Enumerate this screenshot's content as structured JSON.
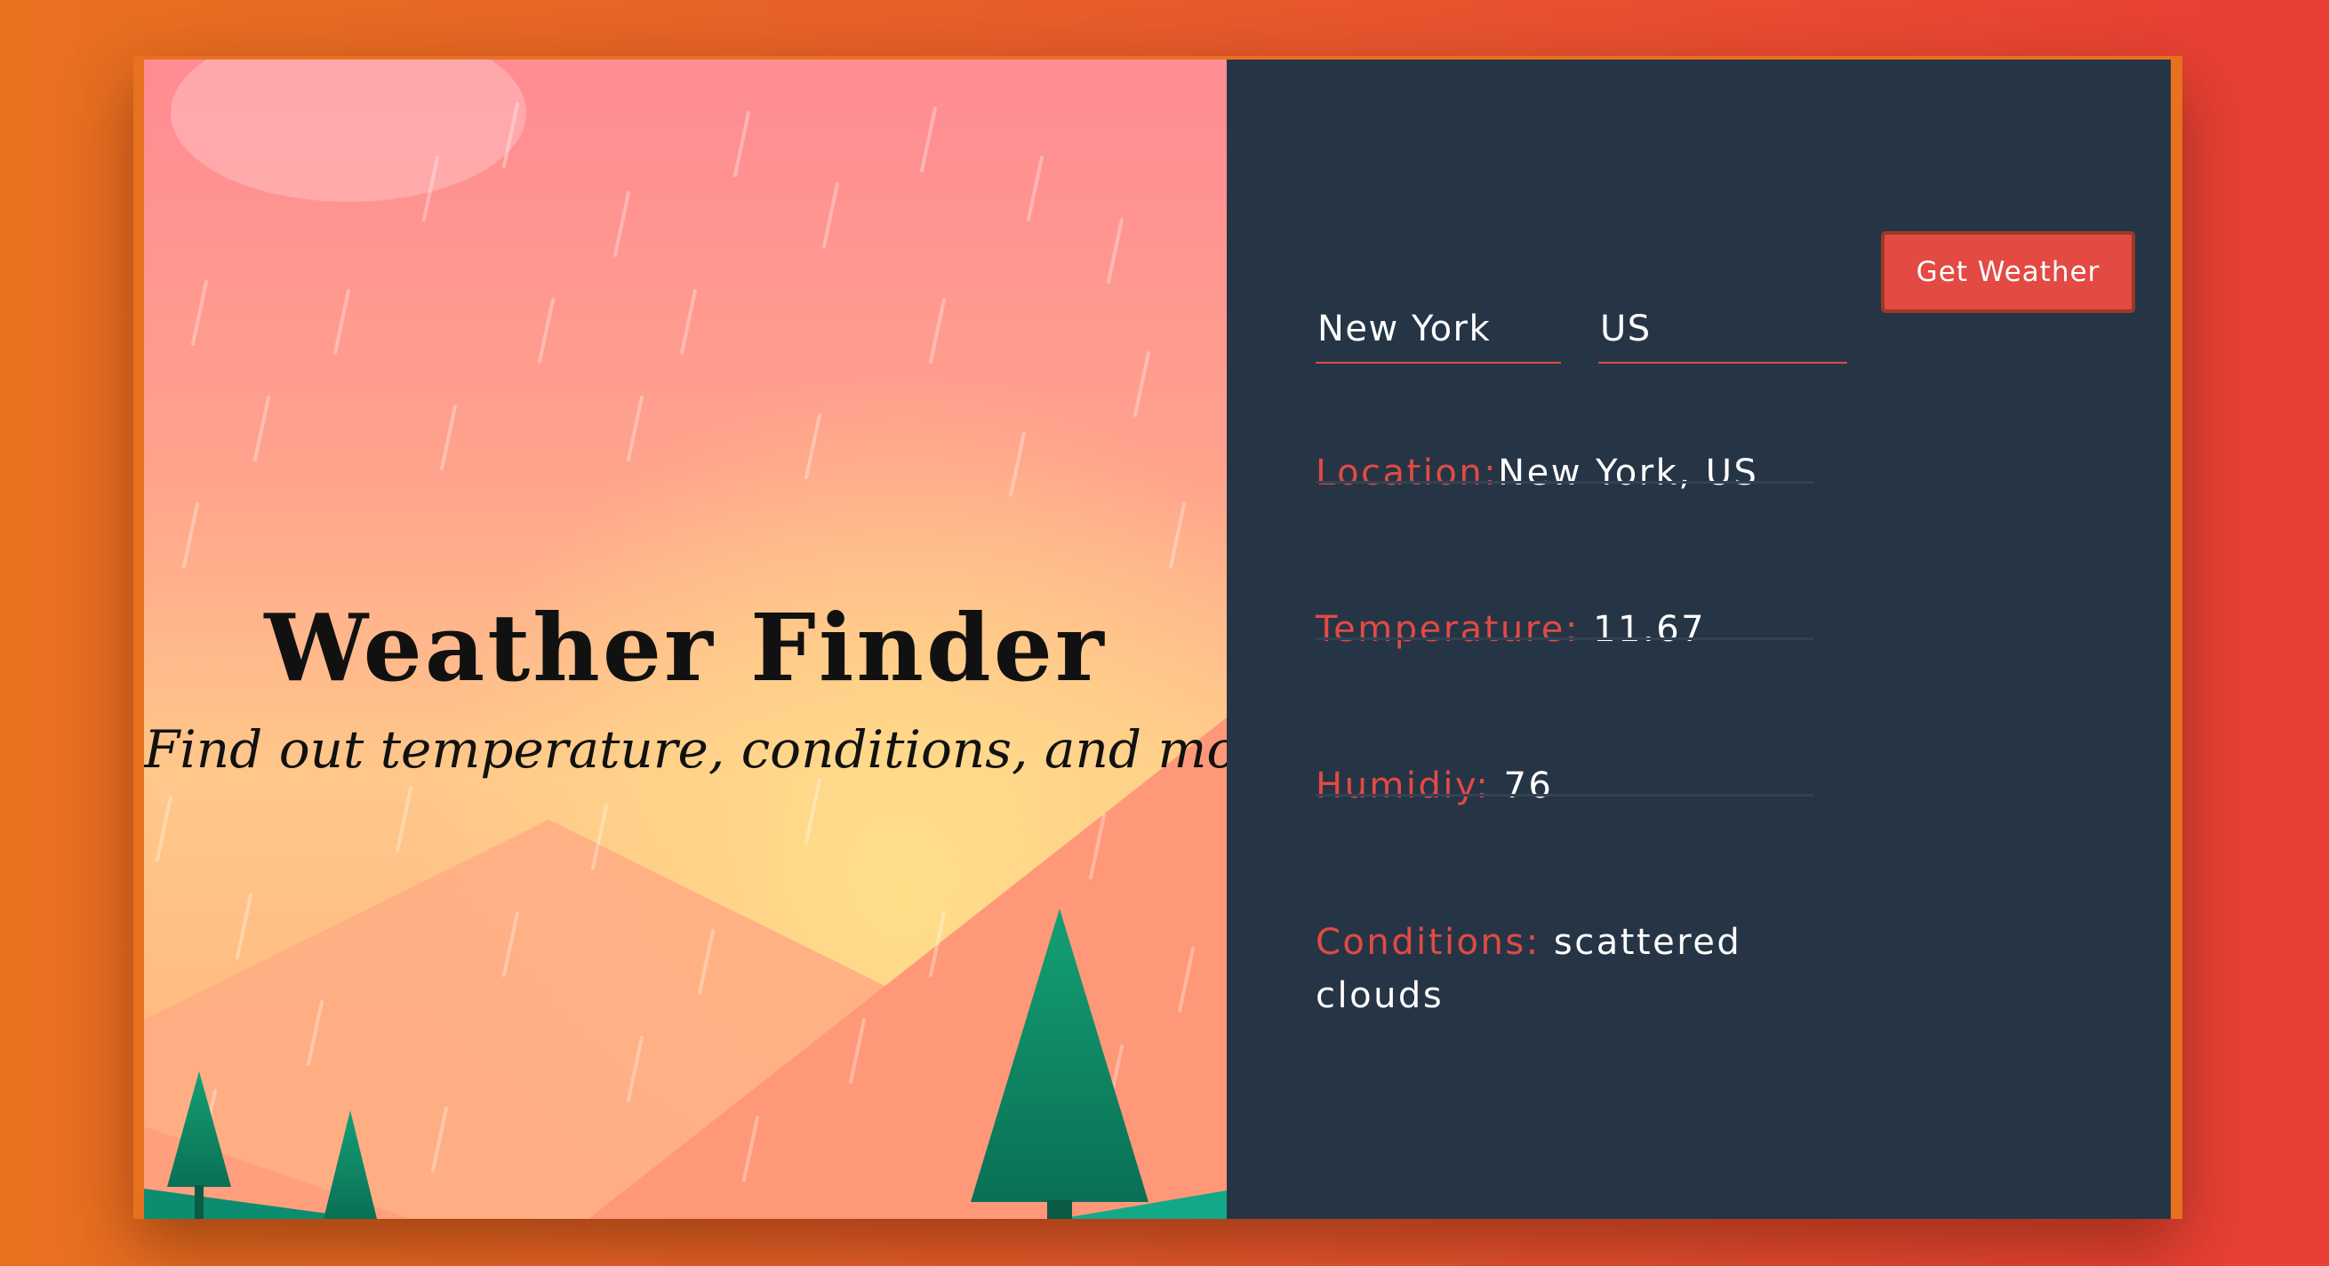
{
  "hero": {
    "title": "Weather Finder",
    "subtitle": "Find out temperature, conditions, and more."
  },
  "form": {
    "city_value": "New York",
    "country_value": "US",
    "button_label": "Get Weather"
  },
  "results": {
    "location_label": "Location:",
    "location_value": "New York, US",
    "temperature_label": "Temperature:",
    "temperature_value": "11.67",
    "humidity_label": "Humidiy:",
    "humidity_value": "76",
    "conditions_label": "Conditions:",
    "conditions_value": "scattered clouds"
  },
  "colors": {
    "accent": "#e24a43",
    "panel": "#263546",
    "background_start": "#e8711f",
    "background_end": "#e83e35"
  },
  "icons": [
    "rain-illustration",
    "mountain-illustration",
    "pine-tree-illustration"
  ]
}
